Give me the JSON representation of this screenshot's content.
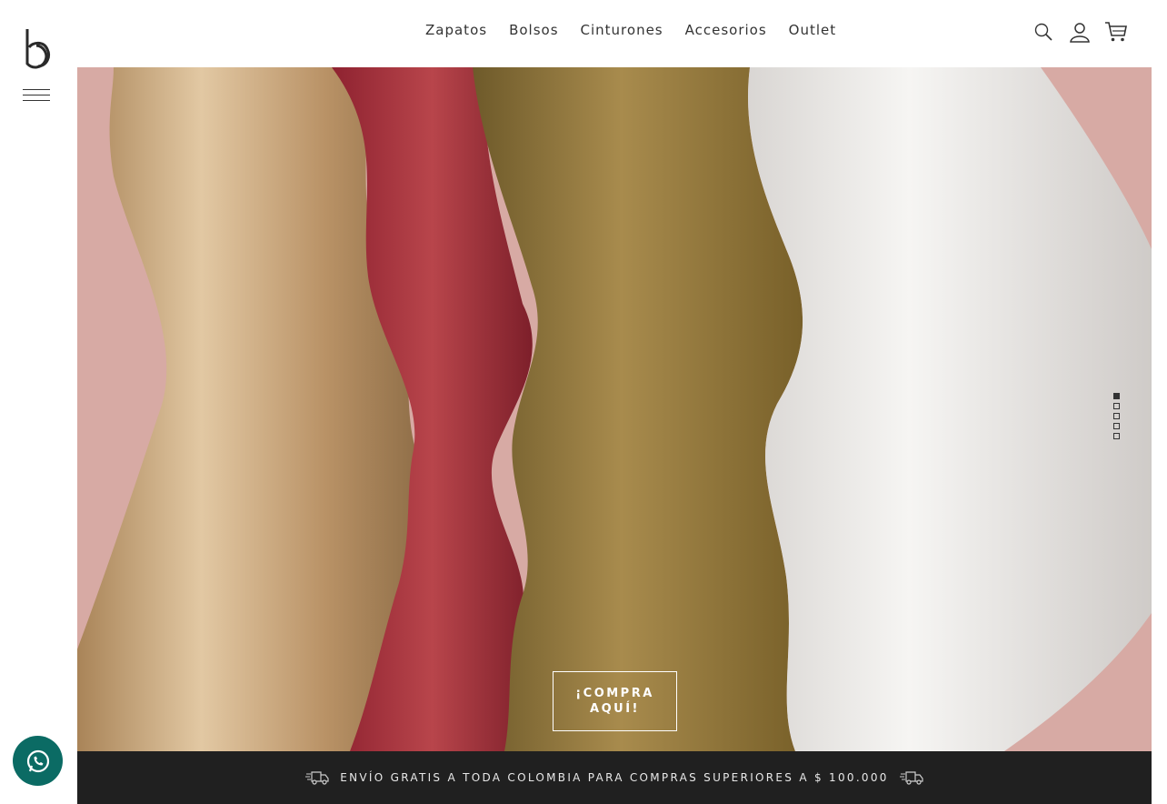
{
  "nav": {
    "items": [
      {
        "label": "Zapatos"
      },
      {
        "label": "Bolsos"
      },
      {
        "label": "Cinturones"
      },
      {
        "label": "Accesorios"
      },
      {
        "label": "Outlet"
      }
    ]
  },
  "header_icons": [
    "search-icon",
    "user-icon",
    "cart-icon"
  ],
  "hero": {
    "cta_label": "¡COMPRA AQUÍ!",
    "slides": {
      "total": 5,
      "active": 1
    }
  },
  "banner": {
    "text": "ENVÍO GRATIS A TODA COLOMBIA PARA COMPRAS SUPERIORES A $ 100.000"
  },
  "colors": {
    "background_pink": "#d7aaa4",
    "gold": "#c9a46d",
    "red": "#a8333a",
    "olive": "#8c7334",
    "white_fabric": "#f2f0ee",
    "banner_bg": "#202020",
    "whatsapp": "#0b6b64"
  }
}
